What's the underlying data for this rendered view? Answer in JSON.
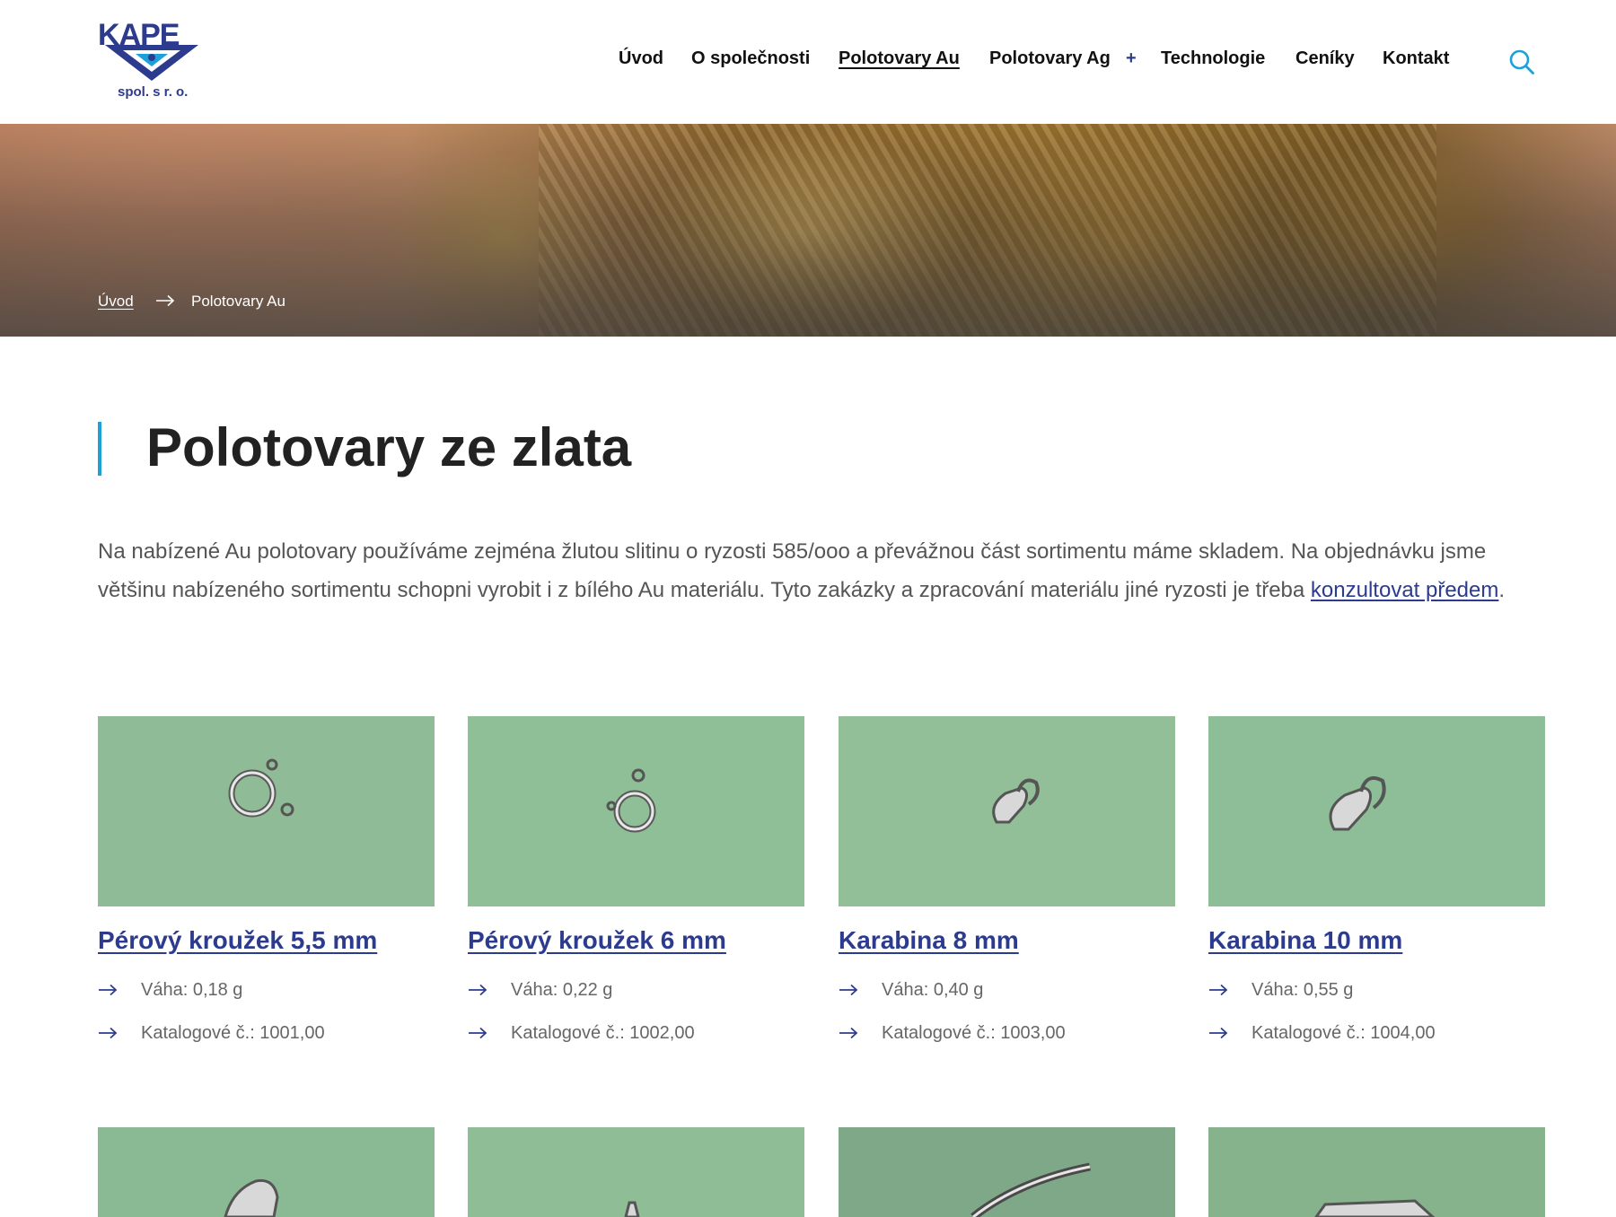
{
  "header": {
    "logo_text": "KAPE",
    "logo_sub": "spol. s r. o.",
    "nav": [
      {
        "label": "Úvod"
      },
      {
        "label": "O společnosti"
      },
      {
        "label": "Polotovary Au"
      },
      {
        "label": "Polotovary Ag"
      },
      {
        "label": "Technologie"
      },
      {
        "label": "Ceníky"
      },
      {
        "label": "Kontakt"
      }
    ],
    "nav_plus": "+",
    "search_icon": "search-icon"
  },
  "breadcrumb": {
    "home": "Úvod",
    "current": "Polotovary Au"
  },
  "main": {
    "title": "Polotovary ze zlata",
    "intro_text": "Na nabízené Au polotovary používáme zejména žlutou slitinu o ryzosti 585/ooo a převážnou část sortimentu máme skladem. Na objednávku jsme většinu nabízeného sortimentu schopni vyrobit i z bílého Au materiálu. Tyto zakázky a zpracování materiálu jiné ryzosti je třeba ",
    "intro_link": "konzultovat předem",
    "intro_end": "."
  },
  "products": [
    {
      "name": "Pérový kroužek 5,5 mm",
      "weight": "Váha: 0,18 g",
      "catalog": "Katalogové č.: 1001,00"
    },
    {
      "name": "Pérový kroužek 6 mm",
      "weight": "Váha: 0,22 g",
      "catalog": "Katalogové č.: 1002,00"
    },
    {
      "name": "Karabina 8 mm",
      "weight": "Váha: 0,40 g",
      "catalog": "Katalogové č.: 1003,00"
    },
    {
      "name": "Karabina 10 mm",
      "weight": "Váha: 0,55 g",
      "catalog": "Katalogové č.: 1004,00"
    }
  ],
  "colors": {
    "accent": "#2d3b8e",
    "title_bar": "#1ea1d9",
    "photo_bg": "#8fbb96"
  }
}
